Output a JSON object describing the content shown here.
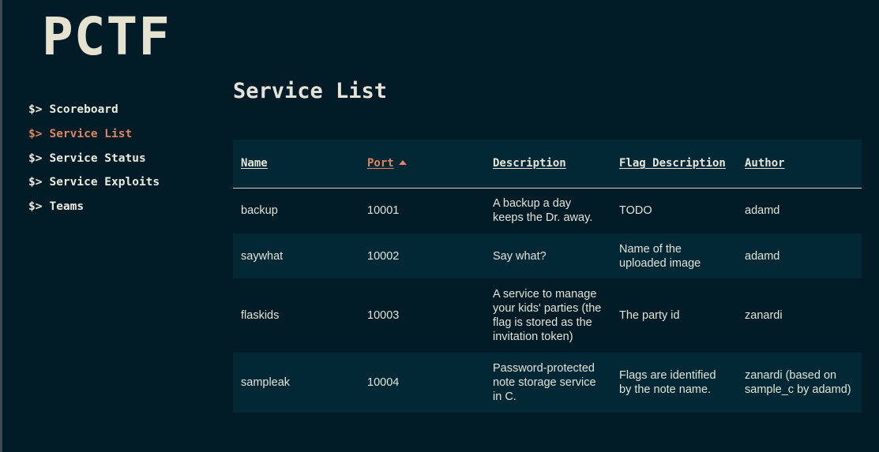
{
  "logo": "PCTF",
  "nav": {
    "prompt": "$>",
    "items": [
      {
        "label": "Scoreboard"
      },
      {
        "label": "Service List"
      },
      {
        "label": "Service Status"
      },
      {
        "label": "Service Exploits"
      },
      {
        "label": "Teams"
      }
    ],
    "active": "Service List",
    "active_color": "#e0855a"
  },
  "page_title": "Service List",
  "table": {
    "headers": {
      "name": "Name",
      "port": "Port",
      "description": "Description",
      "flag_description": "Flag Description",
      "author": "Author"
    },
    "sorted_by": "port",
    "sort_direction": "ascending",
    "rows": [
      {
        "name": "backup",
        "port": "10001",
        "description": "A backup a day keeps the Dr. away.",
        "flag_description": "TODO",
        "author": "adamd"
      },
      {
        "name": "saywhat",
        "port": "10002",
        "description": "Say what?",
        "flag_description": "Name of the uploaded image",
        "author": "adamd"
      },
      {
        "name": "flaskids",
        "port": "10003",
        "description": "A service to manage your kids' parties (the flag is stored as the invitation token)",
        "flag_description": "The party id",
        "author": "zanardi"
      },
      {
        "name": "sampleak",
        "port": "10004",
        "description": "Password-protected note storage service in C.",
        "flag_description": "Flags are identified by the note name.",
        "author": "zanardi (based on sample_c by adamd)"
      }
    ]
  },
  "colors": {
    "background": "#011b27",
    "row_alt": "#022835",
    "accent": "#e0855a"
  }
}
